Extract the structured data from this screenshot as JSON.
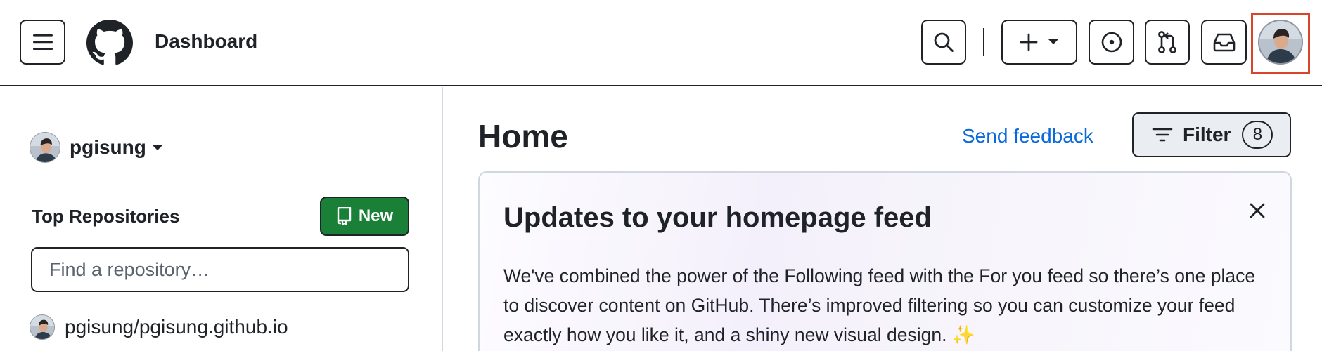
{
  "header": {
    "title": "Dashboard",
    "menu_icon": "hamburger-icon",
    "logo_icon": "github-logo-icon",
    "search_icon": "search-icon",
    "create_icon": "plus-icon",
    "create_caret_icon": "triangle-down-icon",
    "issues_icon": "issue-opened-icon",
    "pulls_icon": "git-pull-request-icon",
    "inbox_icon": "inbox-icon",
    "avatar_icon": "user-avatar"
  },
  "sidebar": {
    "context_user": "pgisung",
    "top_repositories_heading": "Top Repositories",
    "new_button_label": "New",
    "new_button_icon": "repo-icon",
    "find_placeholder": "Find a repository…",
    "find_value": "",
    "repositories": [
      {
        "name": "pgisung/pgisung.github.io"
      }
    ]
  },
  "main": {
    "title": "Home",
    "send_feedback": "Send feedback",
    "filter_label": "Filter",
    "filter_count": "8",
    "filter_icon": "filter-icon",
    "card": {
      "title": "Updates to your homepage feed",
      "close_icon": "x-icon",
      "body": "We've combined the power of the Following feed with the For you feed so there’s one place to discover content on GitHub. There’s improved filtering so you can customize your feed exactly how you like it, and a shiny new visual design. ✨"
    }
  },
  "colors": {
    "accent_link": "#0969da",
    "primary_button": "#1a7f37",
    "highlight_border": "#d9442b",
    "text": "#1f2328"
  }
}
